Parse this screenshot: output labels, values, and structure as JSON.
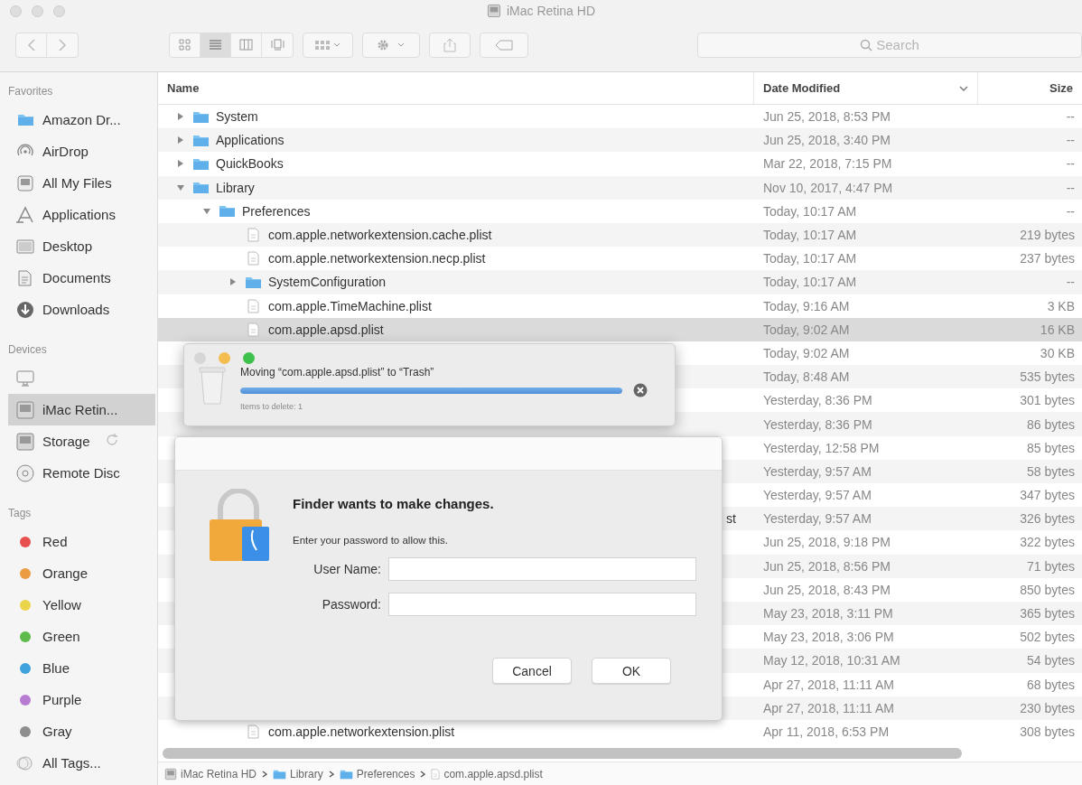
{
  "window": {
    "title": "iMac Retina HD",
    "active": false
  },
  "toolbar": {
    "view_modes": [
      {
        "kind": "icons",
        "selected": false
      },
      {
        "kind": "list",
        "selected": true
      },
      {
        "kind": "columns",
        "selected": false
      },
      {
        "kind": "gallery",
        "selected": false
      }
    ],
    "search": {
      "placeholder": "Search"
    }
  },
  "sidebar": [
    {
      "header": "Favorites",
      "items": [
        {
          "kind": "folder",
          "label": "Amazon Dr...",
          "selected": false
        },
        {
          "kind": "airdrop",
          "label": "AirDrop",
          "selected": false
        },
        {
          "kind": "files",
          "label": "All My Files",
          "selected": false
        },
        {
          "kind": "apps",
          "label": "Applications",
          "selected": false
        },
        {
          "kind": "desktop",
          "label": "Desktop",
          "selected": false
        },
        {
          "kind": "documents",
          "label": "Documents",
          "selected": false
        },
        {
          "kind": "downloads",
          "label": "Downloads",
          "selected": false
        }
      ]
    },
    {
      "header": "Devices",
      "items": [
        {
          "kind": "computer",
          "selected": false
        },
        {
          "kind": "disk",
          "label": "iMac Retin...",
          "selected": true
        },
        {
          "kind": "disk",
          "label": "Storage",
          "selected": false,
          "busy": true
        },
        {
          "kind": "disc",
          "label": "Remote Disc",
          "selected": false
        }
      ]
    },
    {
      "header": "Tags",
      "items": [
        {
          "kind": "tag",
          "label": "Red",
          "color": "#e8504f",
          "selected": false
        },
        {
          "kind": "tag",
          "label": "Orange",
          "color": "#eb9b41",
          "selected": false
        },
        {
          "kind": "tag",
          "label": "Yellow",
          "color": "#e9d44a",
          "selected": false
        },
        {
          "kind": "tag",
          "label": "Green",
          "color": "#5dbb4c",
          "selected": false
        },
        {
          "kind": "tag",
          "label": "Blue",
          "color": "#3fa2dd",
          "selected": false
        },
        {
          "kind": "tag",
          "label": "Purple",
          "color": "#b77bd2",
          "selected": false
        },
        {
          "kind": "tag",
          "label": "Gray",
          "color": "#8e8e8e",
          "selected": false
        },
        {
          "kind": "all-tags",
          "label": "All Tags...",
          "selected": false
        }
      ]
    }
  ],
  "columns": [
    {
      "label": "Name",
      "sorted": false
    },
    {
      "label": "Date Modified",
      "sorted": true
    },
    {
      "label": "Size",
      "sorted": false
    }
  ],
  "files": [
    {
      "kind": "folder",
      "name": "System",
      "expanded": false,
      "date": "Jun 25, 2018, 8:53 PM",
      "size": "--",
      "selected": false
    },
    {
      "kind": "folder",
      "name": "Applications",
      "expanded": false,
      "date": "Jun 25, 2018, 3:40 PM",
      "size": "--",
      "selected": false
    },
    {
      "kind": "folder",
      "name": "QuickBooks",
      "expanded": false,
      "date": "Mar 22, 2018, 7:15 PM",
      "size": "--",
      "selected": false
    },
    {
      "kind": "folder",
      "name": "Library",
      "expanded": true,
      "date": "Nov 10, 2017, 4:47 PM",
      "size": "--",
      "selected": false,
      "children": [
        {
          "kind": "folder",
          "name": "Preferences",
          "expanded": true,
          "date": "Today, 10:17 AM",
          "size": "--",
          "selected": false,
          "children": [
            {
              "kind": "file",
              "name": "com.apple.networkextension.cache.plist",
              "date": "Today, 10:17 AM",
              "size": "219 bytes",
              "selected": false
            },
            {
              "kind": "file",
              "name": "com.apple.networkextension.necp.plist",
              "date": "Today, 10:17 AM",
              "size": "237 bytes",
              "selected": false
            },
            {
              "kind": "folder",
              "name": "SystemConfiguration",
              "expanded": false,
              "date": "Today, 10:17 AM",
              "size": "--",
              "selected": false
            },
            {
              "kind": "file",
              "name": "com.apple.TimeMachine.plist",
              "date": "Today, 9:16 AM",
              "size": "3 KB",
              "selected": false
            },
            {
              "kind": "file",
              "name": "com.apple.apsd.plist",
              "date": "Today, 9:02 AM",
              "size": "16 KB",
              "selected": true
            },
            {
              "kind": "covered",
              "date": "Today, 9:02 AM",
              "size": "30 KB",
              "selected": false
            },
            {
              "kind": "covered",
              "date": "Today, 8:48 AM",
              "size": "535 bytes",
              "selected": false
            },
            {
              "kind": "covered",
              "date": "Yesterday, 8:36 PM",
              "size": "301 bytes",
              "selected": false
            },
            {
              "kind": "covered",
              "date": "Yesterday, 8:36 PM",
              "size": "86 bytes",
              "selected": false
            },
            {
              "kind": "covered",
              "date": "Yesterday, 12:58 PM",
              "size": "85 bytes",
              "selected": false
            },
            {
              "kind": "covered",
              "date": "Yesterday, 9:57 AM",
              "size": "58 bytes",
              "selected": false
            },
            {
              "kind": "covered",
              "date": "Yesterday, 9:57 AM",
              "size": "347 bytes",
              "selected": false
            },
            {
              "kind": "covered",
              "name": "st",
              "date": "Yesterday, 9:57 AM",
              "size": "326 bytes",
              "selected": false
            },
            {
              "kind": "covered",
              "date": "Jun 25, 2018, 9:18 PM",
              "size": "322 bytes",
              "selected": false
            },
            {
              "kind": "covered",
              "date": "Jun 25, 2018, 8:56 PM",
              "size": "71 bytes",
              "selected": false
            },
            {
              "kind": "covered",
              "date": "Jun 25, 2018, 8:43 PM",
              "size": "850 bytes",
              "selected": false
            },
            {
              "kind": "covered",
              "date": "May 23, 2018, 3:11 PM",
              "size": "365 bytes",
              "selected": false
            },
            {
              "kind": "covered",
              "date": "May 23, 2018, 3:06 PM",
              "size": "502 bytes",
              "selected": false
            },
            {
              "kind": "covered",
              "date": "May 12, 2018, 10:31 AM",
              "size": "54 bytes",
              "selected": false
            },
            {
              "kind": "covered",
              "date": "Apr 27, 2018, 11:11 AM",
              "size": "68 bytes",
              "selected": false
            },
            {
              "kind": "covered",
              "date": "Apr 27, 2018, 11:11 AM",
              "size": "230 bytes",
              "selected": false
            },
            {
              "kind": "file",
              "name": "com.apple.networkextension.plist",
              "date": "Apr 11, 2018, 6:53 PM",
              "size": "308 bytes",
              "selected": false
            }
          ]
        }
      ]
    }
  ],
  "path_bar": [
    {
      "kind": "disk",
      "label": "iMac Retina HD"
    },
    {
      "kind": "folder",
      "label": "Library"
    },
    {
      "kind": "folder",
      "label": "Preferences"
    },
    {
      "kind": "file",
      "label": "com.apple.apsd.plist"
    }
  ],
  "progress_window": {
    "message": "Moving “com.apple.apsd.plist” to “Trash”",
    "level": 1,
    "detail": "Items to delete: 1"
  },
  "auth_dialog": {
    "title": "Finder wants to make changes.",
    "message": "Enter your password to allow this.",
    "fields": [
      {
        "label": "User Name:"
      },
      {
        "label": "Password:"
      }
    ],
    "buttons": [
      {
        "label": "Cancel",
        "default": false
      },
      {
        "label": "OK",
        "default": false
      }
    ]
  }
}
